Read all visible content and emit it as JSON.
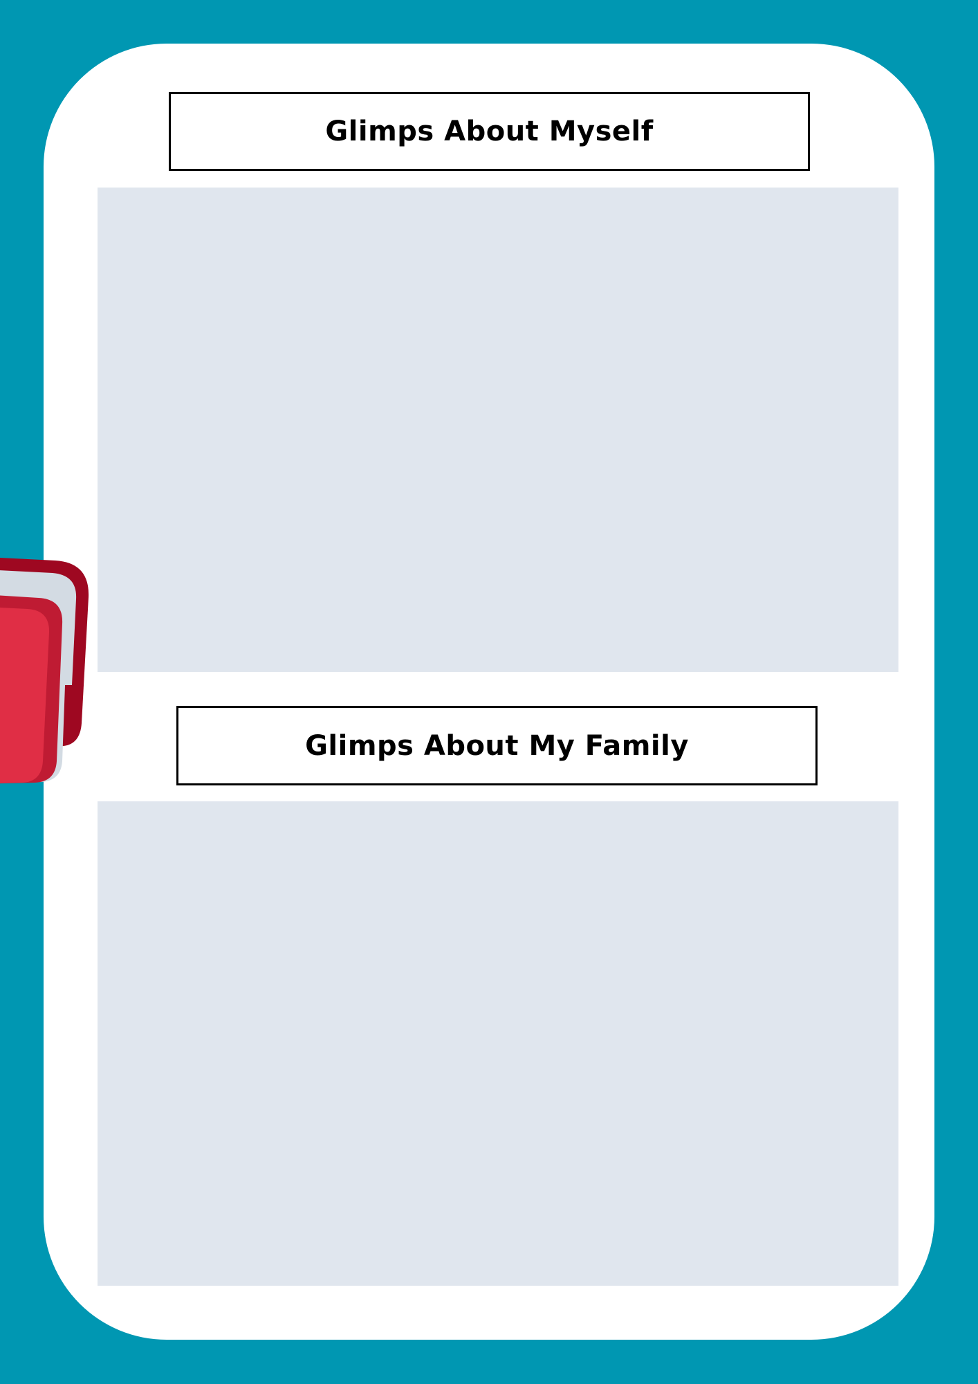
{
  "colors": {
    "background": "#0097b2",
    "card": "#ffffff",
    "photo_placeholder": "#e0e6ee",
    "book_dark_red": "#9e0821",
    "book_mid_red": "#bf1b33",
    "book_light_red": "#e02e45",
    "book_pages": "#d3dbe3",
    "title_border": "#000000"
  },
  "sections": [
    {
      "title": "Glimps About Myself",
      "placeholder": "photo-placeholder"
    },
    {
      "title": "Glimps About My Family",
      "placeholder": "photo-placeholder"
    }
  ],
  "decoration": {
    "icon": "books-icon"
  }
}
